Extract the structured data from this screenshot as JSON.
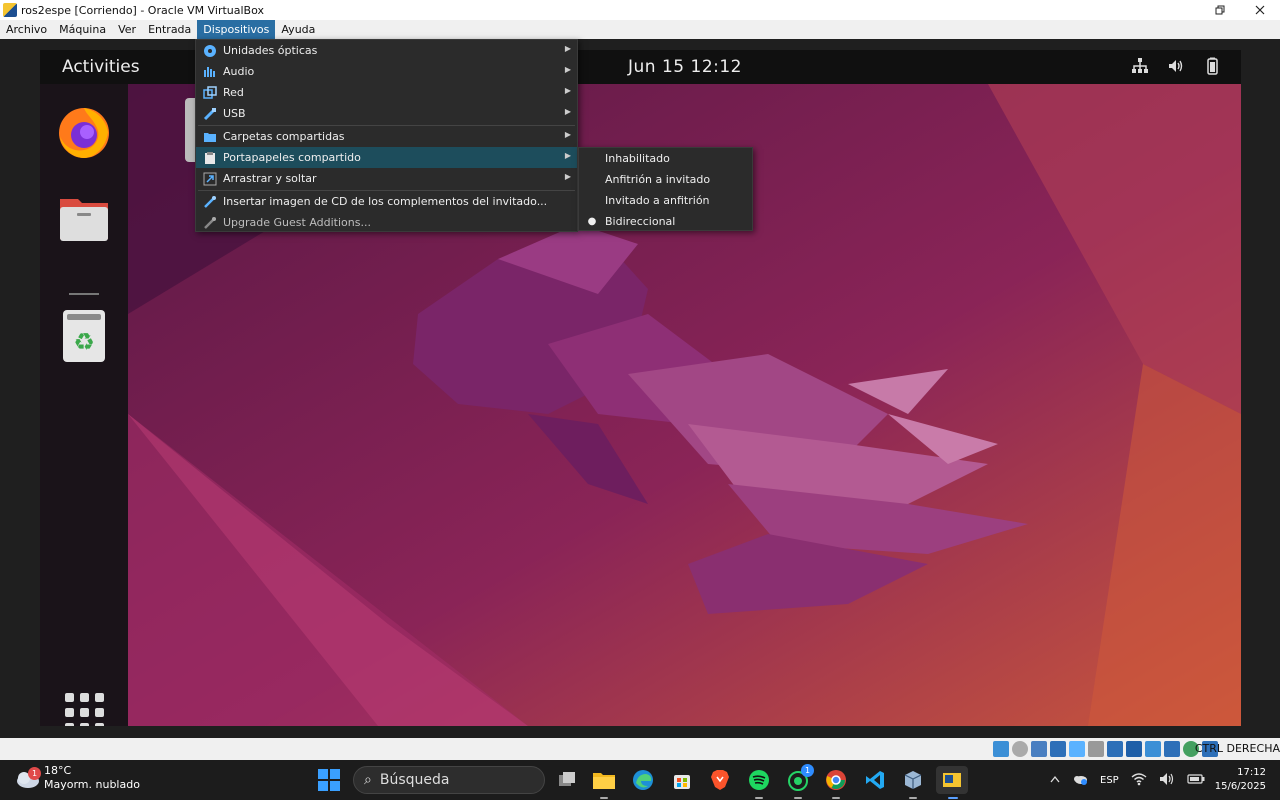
{
  "window": {
    "title": "ros2espe [Corriendo] - Oracle VM VirtualBox",
    "restore_icon": "restore-icon",
    "close_icon": "close-icon"
  },
  "menubar": [
    "Archivo",
    "Máquina",
    "Ver",
    "Entrada",
    "Dispositivos",
    "Ayuda"
  ],
  "guest": {
    "activities": "Activities",
    "clock": "Jun 15  12:12",
    "tray_icons": [
      "network-icon",
      "volume-icon",
      "battery-icon"
    ]
  },
  "devices_menu": {
    "items": [
      {
        "label": "Unidades ópticas",
        "icon": "optical-disc-icon",
        "submenu": true
      },
      {
        "label": "Audio",
        "icon": "audio-icon",
        "submenu": true
      },
      {
        "label": "Red",
        "icon": "network-icon",
        "submenu": true
      },
      {
        "label": "USB",
        "icon": "usb-icon",
        "submenu": true
      },
      {
        "label": "Carpetas compartidas",
        "icon": "shared-folder-icon",
        "submenu": true
      },
      {
        "label": "Portapapeles compartido",
        "icon": "clipboard-icon",
        "submenu": true,
        "highlighted": true
      },
      {
        "label": "Arrastrar y soltar",
        "icon": "drag-drop-icon",
        "submenu": true
      },
      {
        "label": "Insertar imagen de CD de los complementos del invitado...",
        "icon": "insert-cd-icon",
        "submenu": false
      },
      {
        "label": "Upgrade Guest Additions...",
        "icon": "upgrade-icon",
        "submenu": false,
        "disabled": true
      }
    ]
  },
  "clipboard_submenu": {
    "items": [
      {
        "label": "Inhabilitado",
        "selected": false
      },
      {
        "label": "Anfitrión a invitado",
        "selected": false
      },
      {
        "label": "Invitado a anfitrión",
        "selected": false
      },
      {
        "label": "Bidireccional",
        "selected": true
      }
    ]
  },
  "statusbar": {
    "host_key": "CTRL DERECHA"
  },
  "taskbar": {
    "weather_temp": "18°C",
    "weather_desc": "Mayorm. nublado",
    "weather_badge": "1",
    "search_placeholder": "Búsqueda",
    "apps": [
      "task-view",
      "file-explorer",
      "edge",
      "store",
      "brave",
      "spotify",
      "whatsapp",
      "chrome",
      "vscode",
      "virtualbox-manager",
      "virtualbox-vm"
    ],
    "whatsapp_badge": "1",
    "language": "ESP",
    "time": "17:12",
    "date": "15/6/2025"
  },
  "colors": {
    "menu_bg": "#2b2b2b",
    "menu_highlight": "#1d4d5c",
    "menubar_active": "#2a6ea3",
    "wallpaper_base": "#5d1b4e"
  }
}
